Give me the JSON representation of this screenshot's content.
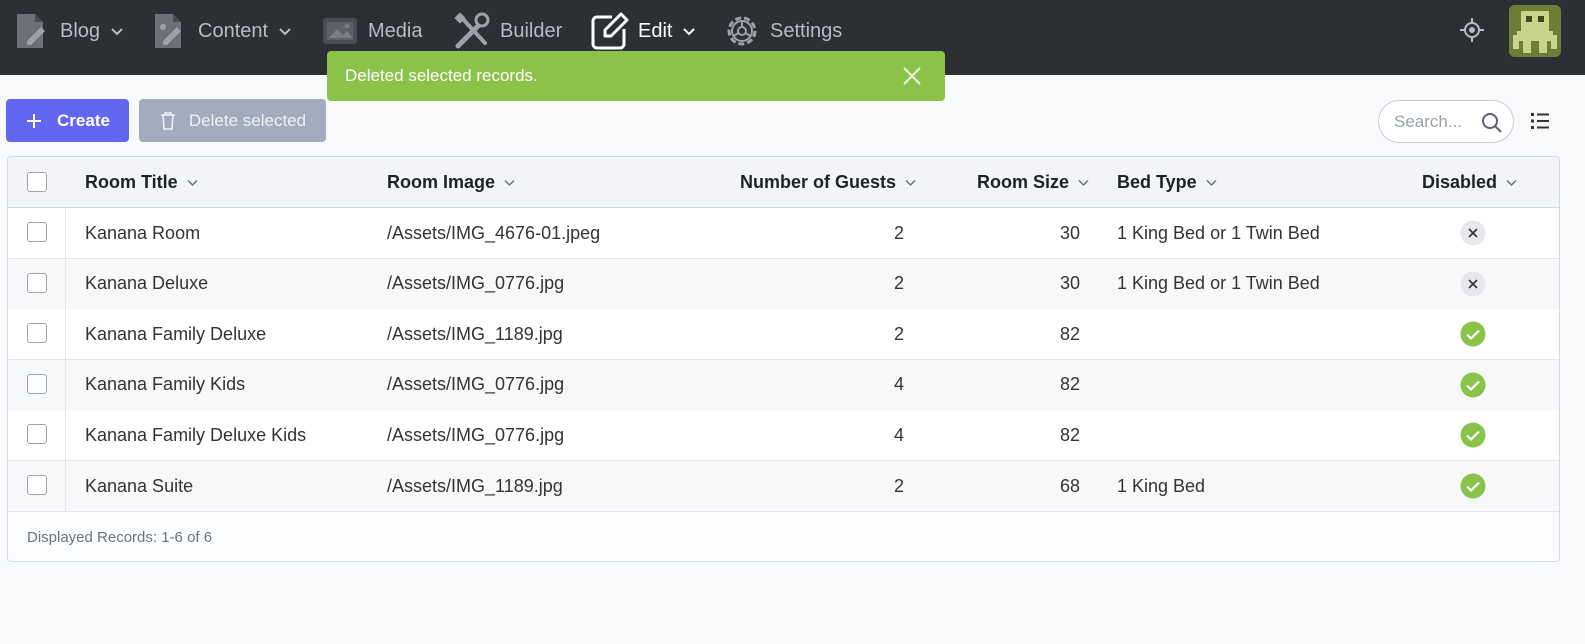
{
  "nav": {
    "items": [
      {
        "label": "Blog",
        "icon": "blog-edit-icon",
        "has_dropdown": true
      },
      {
        "label": "Content",
        "icon": "content-edit-icon",
        "has_dropdown": true
      },
      {
        "label": "Media",
        "icon": "media-icon",
        "has_dropdown": false
      },
      {
        "label": "Builder",
        "icon": "tools-icon",
        "has_dropdown": false
      },
      {
        "label": "Edit",
        "icon": "pencil-square-icon",
        "has_dropdown": true,
        "active": true
      },
      {
        "label": "Settings",
        "icon": "gear-icon",
        "has_dropdown": false
      }
    ],
    "right_icons": [
      "crosshair-icon",
      "avatar"
    ]
  },
  "toast": {
    "message": "Deleted selected records.",
    "color": "#8bc34a"
  },
  "toolbar": {
    "create_label": "Create",
    "delete_label": "Delete selected",
    "search_placeholder": "Search...",
    "accent": "#6366f1"
  },
  "table": {
    "columns": [
      "Room Title",
      "Room Image",
      "Number of Guests",
      "Room Size",
      "Bed Type",
      "Disabled"
    ],
    "rows": [
      {
        "title": "Kanana Room",
        "image": "/Assets/IMG_4676-01.jpeg",
        "guests": "2",
        "size": "30",
        "bed": "1 King Bed or 1 Twin Bed",
        "disabled": false
      },
      {
        "title": "Kanana Deluxe",
        "image": "/Assets/IMG_0776.jpg",
        "guests": "2",
        "size": "30",
        "bed": "1 King Bed or 1 Twin Bed",
        "disabled": false
      },
      {
        "title": "Kanana Family Deluxe",
        "image": "/Assets/IMG_1189.jpg",
        "guests": "2",
        "size": "82",
        "bed": "",
        "disabled": true
      },
      {
        "title": "Kanana Family Kids",
        "image": "/Assets/IMG_0776.jpg",
        "guests": "4",
        "size": "82",
        "bed": "",
        "disabled": true
      },
      {
        "title": "Kanana Family Deluxe Kids",
        "image": "/Assets/IMG_0776.jpg",
        "guests": "4",
        "size": "82",
        "bed": "",
        "disabled": true
      },
      {
        "title": "Kanana Suite",
        "image": "/Assets/IMG_1189.jpg",
        "guests": "2",
        "size": "68",
        "bed": "1 King Bed",
        "disabled": true
      }
    ],
    "footer": "Displayed Records: 1-6 of 6"
  },
  "colors": {
    "topbar": "#2c2f33",
    "check_green": "#8bc34a"
  }
}
